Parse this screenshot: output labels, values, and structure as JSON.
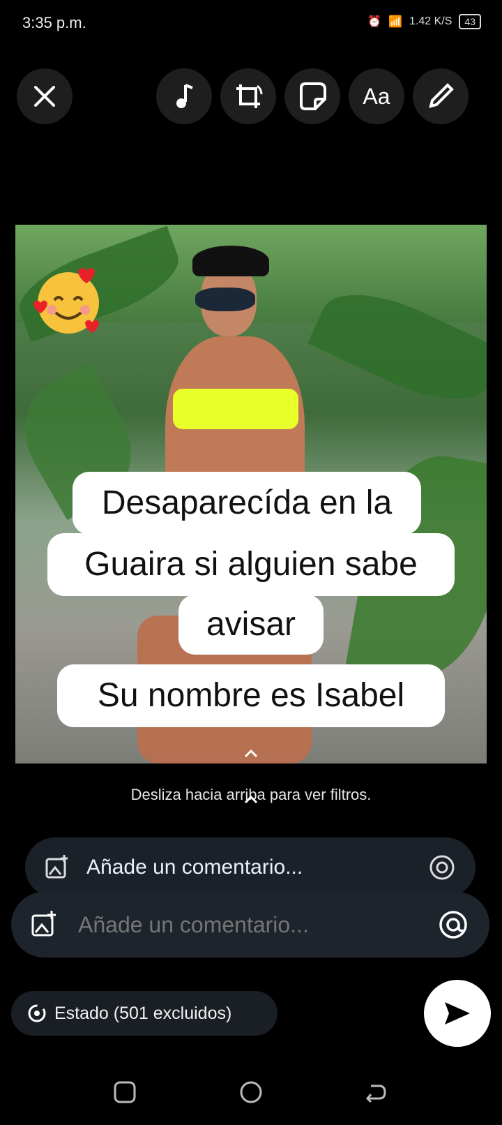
{
  "status_bar": {
    "time": "3:35 p.m.",
    "speed": "1.42 K/S",
    "battery": "43"
  },
  "toolbar": {
    "text_label": "Aa"
  },
  "captions": [
    "Desaparecída en la",
    "Guaira si alguien sabe",
    "avisar",
    "Su nombre es Isabel"
  ],
  "hint": "Desliza hacia arriba para ver filtros.",
  "comment": {
    "placeholder": "Añade un comentario..."
  },
  "audience": {
    "label": "Estado (501 excluidos)"
  },
  "colors": {
    "accent": "#e8ff2a",
    "bar": "#1d242c"
  }
}
